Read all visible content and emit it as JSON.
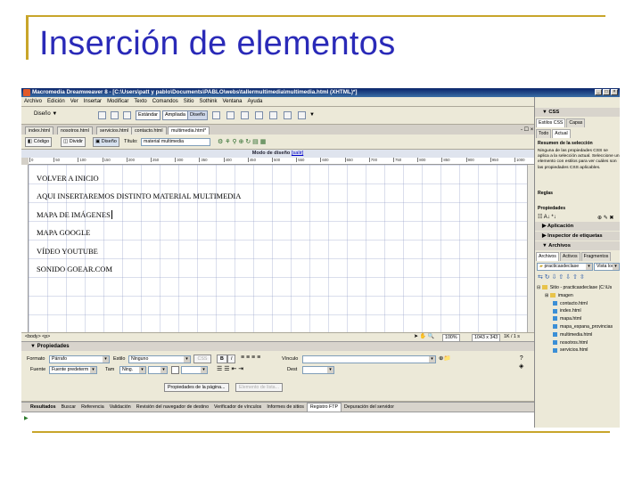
{
  "slide": {
    "title": "Inserción de elementos"
  },
  "window": {
    "title": "Macromedia Dreamweaver 8 - [C:\\Users\\patt y pablo\\Documents\\PABLO\\webs\\tallermultimedia\\multimedia.html (XHTML)*]"
  },
  "menu": [
    "Archivo",
    "Edición",
    "Ver",
    "Insertar",
    "Modificar",
    "Texto",
    "Comandos",
    "Sitio",
    "Sothink",
    "Ventana",
    "Ayuda"
  ],
  "insert_bar": {
    "category": "Diseño",
    "mode_standard": "Estándar",
    "mode_expanded": "Ampliada",
    "mode_layout": "Diseño"
  },
  "doc_tabs": [
    "index.html",
    "nosotros.html",
    "servicios.html",
    "contacto.html",
    "multimedia.html*"
  ],
  "doc_toolbar": {
    "code": "Código",
    "split": "Dividir",
    "design": "Diseño",
    "title_label": "Título:",
    "title_value": "material multimedia"
  },
  "design_mode": {
    "label": "Modo de diseño",
    "exit": "[salir]"
  },
  "ruler_ticks": [
    "0",
    "50",
    "100",
    "150",
    "200",
    "250",
    "300",
    "350",
    "400",
    "450",
    "500",
    "550",
    "600",
    "650",
    "700",
    "750",
    "800",
    "850",
    "900",
    "950",
    "1000"
  ],
  "content": [
    "VOLVER A INICIO",
    "AQUI INSERTAREMOS DISTINTO MATERIAL MULTIMEDIA",
    "MAPA DE IMÁGENES",
    "MAPA GOOGLE",
    "VÍDEO YOUTUBE",
    "SONIDO GOEAR.COM"
  ],
  "status": {
    "tags": "<body> <p>",
    "zoom": "100%",
    "size": "1043 x 343",
    "weight": "1K / 1 s"
  },
  "properties": {
    "header": "Propiedades",
    "format_label": "Formato",
    "format_value": "Párrafo",
    "style_label": "Estilo",
    "style_value": "Ninguno",
    "css_button": "CSS",
    "link_label": "Vínculo",
    "font_label": "Fuente",
    "font_value": "Fuente predeterm",
    "size_label": "Tam",
    "size_value": "Ning.",
    "target_label": "Dest",
    "page_props_button": "Propiedades de la página...",
    "list_item_button": "Elemento de lista..."
  },
  "results": {
    "header": "Resultados",
    "tabs": [
      "Buscar",
      "Referencia",
      "Validación",
      "Revisión del navegador de destino",
      "Verificador de vínculos",
      "Informes de sitios",
      "Registro FTP",
      "Depuración del servidor"
    ]
  },
  "css_panel": {
    "header": "CSS",
    "tabs": [
      "Estilos CSS",
      "Capas"
    ],
    "subtabs": [
      "Todo",
      "Actual"
    ],
    "summary_title": "Resumen de la selección",
    "summary_text": "Ninguna de las propiedades CSS se aplica a la selección actual. Seleccione un elemento con estilos para ver cuáles son las propiedades CSS aplicables.",
    "rules": "Reglas",
    "properties": "Propiedades"
  },
  "app_panel": {
    "application": "Aplicación",
    "tag_inspector": "Inspector de etiquetas"
  },
  "files_panel": {
    "header": "Archivos",
    "tabs": [
      "Archivos",
      "Activos",
      "Fragmentos"
    ],
    "site": "practicasdeclase",
    "view": "Vista local",
    "root": "Sitio - practicasdeclase (C:\\Us",
    "folder": "imagen",
    "files": [
      "contacto.html",
      "index.html",
      "mapa.html",
      "mapa_espana_provincias",
      "multimedia.html",
      "nosotros.html",
      "servicios.html"
    ]
  }
}
